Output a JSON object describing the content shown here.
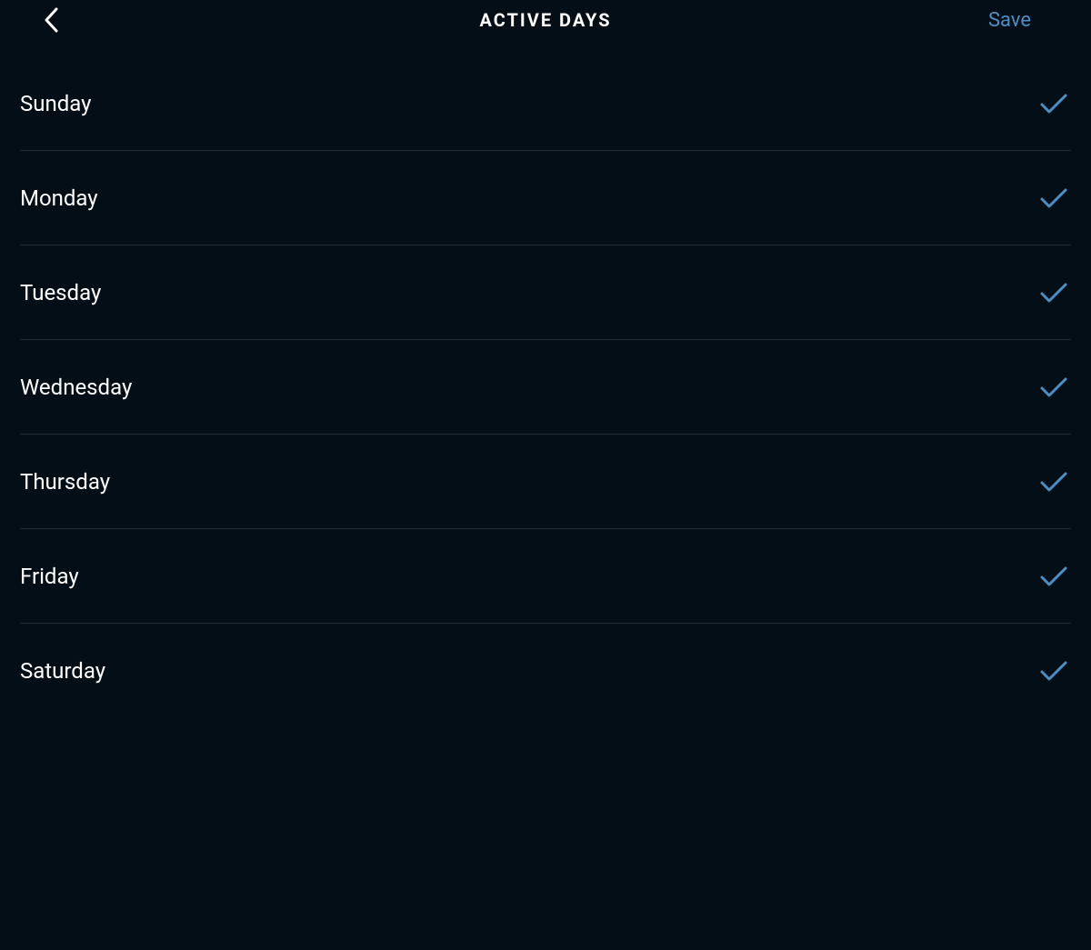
{
  "header": {
    "title": "ACTIVE DAYS",
    "save_label": "Save"
  },
  "colors": {
    "accent": "#4a90c7",
    "background": "#030e17",
    "divider": "#232b32",
    "text": "#ffffff"
  },
  "days": [
    {
      "label": "Sunday",
      "selected": true
    },
    {
      "label": "Monday",
      "selected": true
    },
    {
      "label": "Tuesday",
      "selected": true
    },
    {
      "label": "Wednesday",
      "selected": true
    },
    {
      "label": "Thursday",
      "selected": true
    },
    {
      "label": "Friday",
      "selected": true
    },
    {
      "label": "Saturday",
      "selected": true
    }
  ]
}
